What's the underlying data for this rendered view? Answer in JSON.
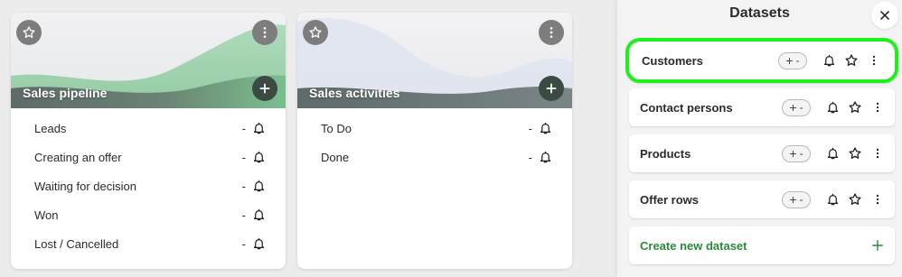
{
  "cards": [
    {
      "title": "Sales pipeline",
      "rows": [
        {
          "label": "Leads",
          "value": "-"
        },
        {
          "label": "Creating an offer",
          "value": "-"
        },
        {
          "label": "Waiting for decision",
          "value": "-"
        },
        {
          "label": "Won",
          "value": "-"
        },
        {
          "label": "Lost / Cancelled",
          "value": "-"
        }
      ]
    },
    {
      "title": "Sales activities",
      "rows": [
        {
          "label": "To Do",
          "value": "-"
        },
        {
          "label": "Done",
          "value": "-"
        }
      ]
    }
  ],
  "panel": {
    "title": "Datasets",
    "items": [
      {
        "name": "Customers",
        "pm_plus": "+",
        "pm_minus": "-"
      },
      {
        "name": "Contact persons",
        "pm_plus": "+",
        "pm_minus": "-"
      },
      {
        "name": "Products",
        "pm_plus": "+",
        "pm_minus": "-"
      },
      {
        "name": "Offer rows",
        "pm_plus": "+",
        "pm_minus": "-"
      }
    ],
    "create_label": "Create new dataset"
  },
  "colors": {
    "highlight": "#1ef01e",
    "create_accent": "#2a8a3a",
    "card_header_dark": "#3b4a42"
  },
  "icons": [
    "star-icon",
    "more-vertical-icon",
    "plus-icon",
    "bell-icon",
    "close-icon"
  ]
}
